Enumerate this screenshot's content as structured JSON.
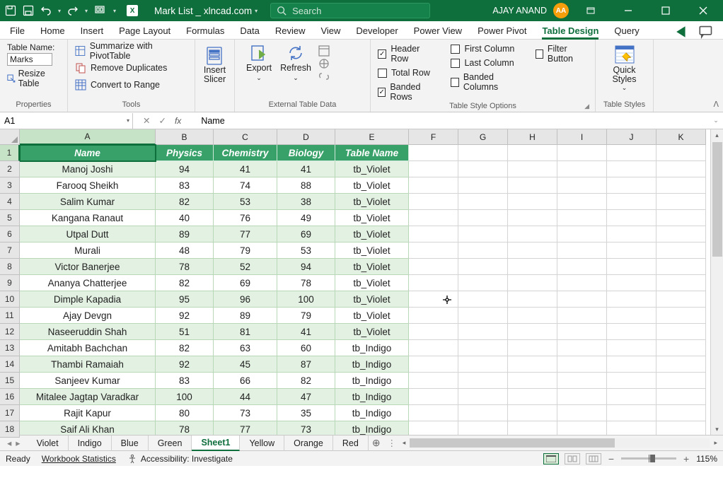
{
  "titlebar": {
    "doc": "Mark List _ xlncad.com",
    "search_ph": "Search",
    "user": "AJAY ANAND",
    "initials": "AA"
  },
  "tabs": [
    "File",
    "Home",
    "Insert",
    "Page Layout",
    "Formulas",
    "Data",
    "Review",
    "View",
    "Developer",
    "Power View",
    "Power Pivot",
    "Table Design",
    "Query"
  ],
  "active_tab": "Table Design",
  "ribbon": {
    "properties": {
      "label": "Properties",
      "table_name_label": "Table Name:",
      "table_name": "Marks",
      "resize": "Resize Table"
    },
    "tools": {
      "label": "Tools",
      "pivot": "Summarize with PivotTable",
      "dup": "Remove Duplicates",
      "range": "Convert to Range",
      "slicer": "Insert Slicer"
    },
    "external": {
      "label": "External Table Data",
      "export": "Export",
      "refresh": "Refresh"
    },
    "tso": {
      "label": "Table Style Options",
      "header": "Header Row",
      "total": "Total Row",
      "banded_r": "Banded Rows",
      "first": "First Column",
      "last": "Last Column",
      "banded_c": "Banded Columns",
      "filter": "Filter Button"
    },
    "styles": {
      "label": "Table Styles",
      "quick": "Quick Styles"
    }
  },
  "namebox": "A1",
  "formula": "Name",
  "cols": [
    "A",
    "B",
    "C",
    "D",
    "E",
    "F",
    "G",
    "H",
    "I",
    "J",
    "K"
  ],
  "col_widths": [
    "wa",
    "wb",
    "wc",
    "wd",
    "we",
    "wrest",
    "wrest",
    "wrest",
    "wrest",
    "wrest",
    "wrest"
  ],
  "headers": [
    "Name",
    "Physics",
    "Chemistry",
    "Biology",
    "Table Name"
  ],
  "rows": [
    [
      "Manoj Joshi",
      "94",
      "41",
      "41",
      "tb_Violet"
    ],
    [
      "Farooq Sheikh",
      "83",
      "74",
      "88",
      "tb_Violet"
    ],
    [
      "Salim Kumar",
      "82",
      "53",
      "38",
      "tb_Violet"
    ],
    [
      "Kangana Ranaut",
      "40",
      "76",
      "49",
      "tb_Violet"
    ],
    [
      "Utpal Dutt",
      "89",
      "77",
      "69",
      "tb_Violet"
    ],
    [
      "Murali",
      "48",
      "79",
      "53",
      "tb_Violet"
    ],
    [
      "Victor Banerjee",
      "78",
      "52",
      "94",
      "tb_Violet"
    ],
    [
      "Ananya Chatterjee",
      "82",
      "69",
      "78",
      "tb_Violet"
    ],
    [
      "Dimple Kapadia",
      "95",
      "96",
      "100",
      "tb_Violet"
    ],
    [
      "Ajay Devgn",
      "92",
      "89",
      "79",
      "tb_Violet"
    ],
    [
      "Naseeruddin Shah",
      "51",
      "81",
      "41",
      "tb_Violet"
    ],
    [
      "Amitabh Bachchan",
      "82",
      "63",
      "60",
      "tb_Indigo"
    ],
    [
      "Thambi Ramaiah",
      "92",
      "45",
      "87",
      "tb_Indigo"
    ],
    [
      "Sanjeev Kumar",
      "83",
      "66",
      "82",
      "tb_Indigo"
    ],
    [
      "Mitalee Jagtap Varadkar",
      "100",
      "44",
      "47",
      "tb_Indigo"
    ],
    [
      "Rajit Kapur",
      "80",
      "73",
      "35",
      "tb_Indigo"
    ],
    [
      "Saif Ali Khan",
      "78",
      "77",
      "73",
      "tb_Indigo"
    ]
  ],
  "sheets": [
    "Violet",
    "Indigo",
    "Blue",
    "Green",
    "Sheet1",
    "Yellow",
    "Orange",
    "Red"
  ],
  "active_sheet": "Sheet1",
  "status": {
    "ready": "Ready",
    "wb": "Workbook Statistics",
    "acc": "Accessibility: Investigate",
    "zoom": "115%"
  }
}
